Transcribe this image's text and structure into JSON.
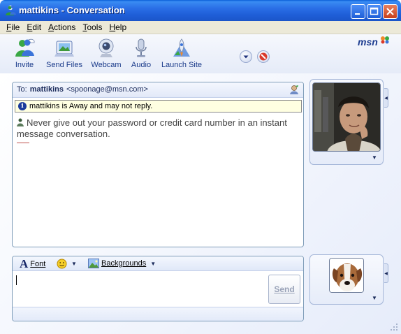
{
  "window": {
    "title": "mattikins - Conversation"
  },
  "menu": [
    {
      "label": "File",
      "accel": "F",
      "rest": "ile"
    },
    {
      "label": "Edit",
      "accel": "E",
      "rest": "dit"
    },
    {
      "label": "Actions",
      "accel": "A",
      "rest": "ctions"
    },
    {
      "label": "Tools",
      "accel": "T",
      "rest": "ools"
    },
    {
      "label": "Help",
      "accel": "H",
      "rest": "elp"
    }
  ],
  "toolbar": {
    "invite": "Invite",
    "send_files": "Send Files",
    "webcam": "Webcam",
    "audio": "Audio",
    "launch_site": "Launch Site",
    "brand": "msn"
  },
  "conversation": {
    "to_label": "To:",
    "contact_name": "mattikins",
    "contact_email": "<spoonage@msn.com>",
    "status_note": "mattikins is Away and may not reply.",
    "warning": "Never give out your password or credit card number in an instant message conversation."
  },
  "compose": {
    "font_label": "Font",
    "backgrounds_label": "Backgrounds",
    "message_value": "",
    "send_label": "Send"
  },
  "icons": {
    "window": "msn-buddy-icon",
    "invite": "invite-buddies-icon",
    "send_files": "send-files-icon",
    "webcam": "webcam-icon",
    "audio": "microphone-icon",
    "launch_site": "launch-site-icon",
    "more": "chevron-down-icon",
    "block": "block-icon",
    "contact_card": "contact-card-icon",
    "info": "info-icon",
    "emoticon": "smiley-icon",
    "backgrounds": "background-image-icon"
  },
  "colors": {
    "titlebar": "#1f5fd8",
    "toolbar_text": "#1a3a8a",
    "status_note_bg": "#ffffe1",
    "panel_border": "#7f9db9"
  }
}
